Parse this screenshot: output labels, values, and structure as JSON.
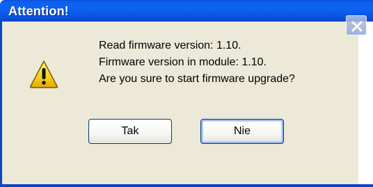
{
  "window": {
    "title": "Attention!",
    "close_icon": "close-icon"
  },
  "message": {
    "icon": "warning-icon",
    "lines": [
      "Read firmware version: 1.10.",
      "Firmware version in module: 1.10.",
      "Are you sure to start firmware upgrade?"
    ]
  },
  "buttons": {
    "yes_label": "Tak",
    "no_label": "Nie"
  },
  "colors": {
    "titlebar": "#0a57e6",
    "body": "#ece9d8",
    "warning": "#f6d31a"
  }
}
